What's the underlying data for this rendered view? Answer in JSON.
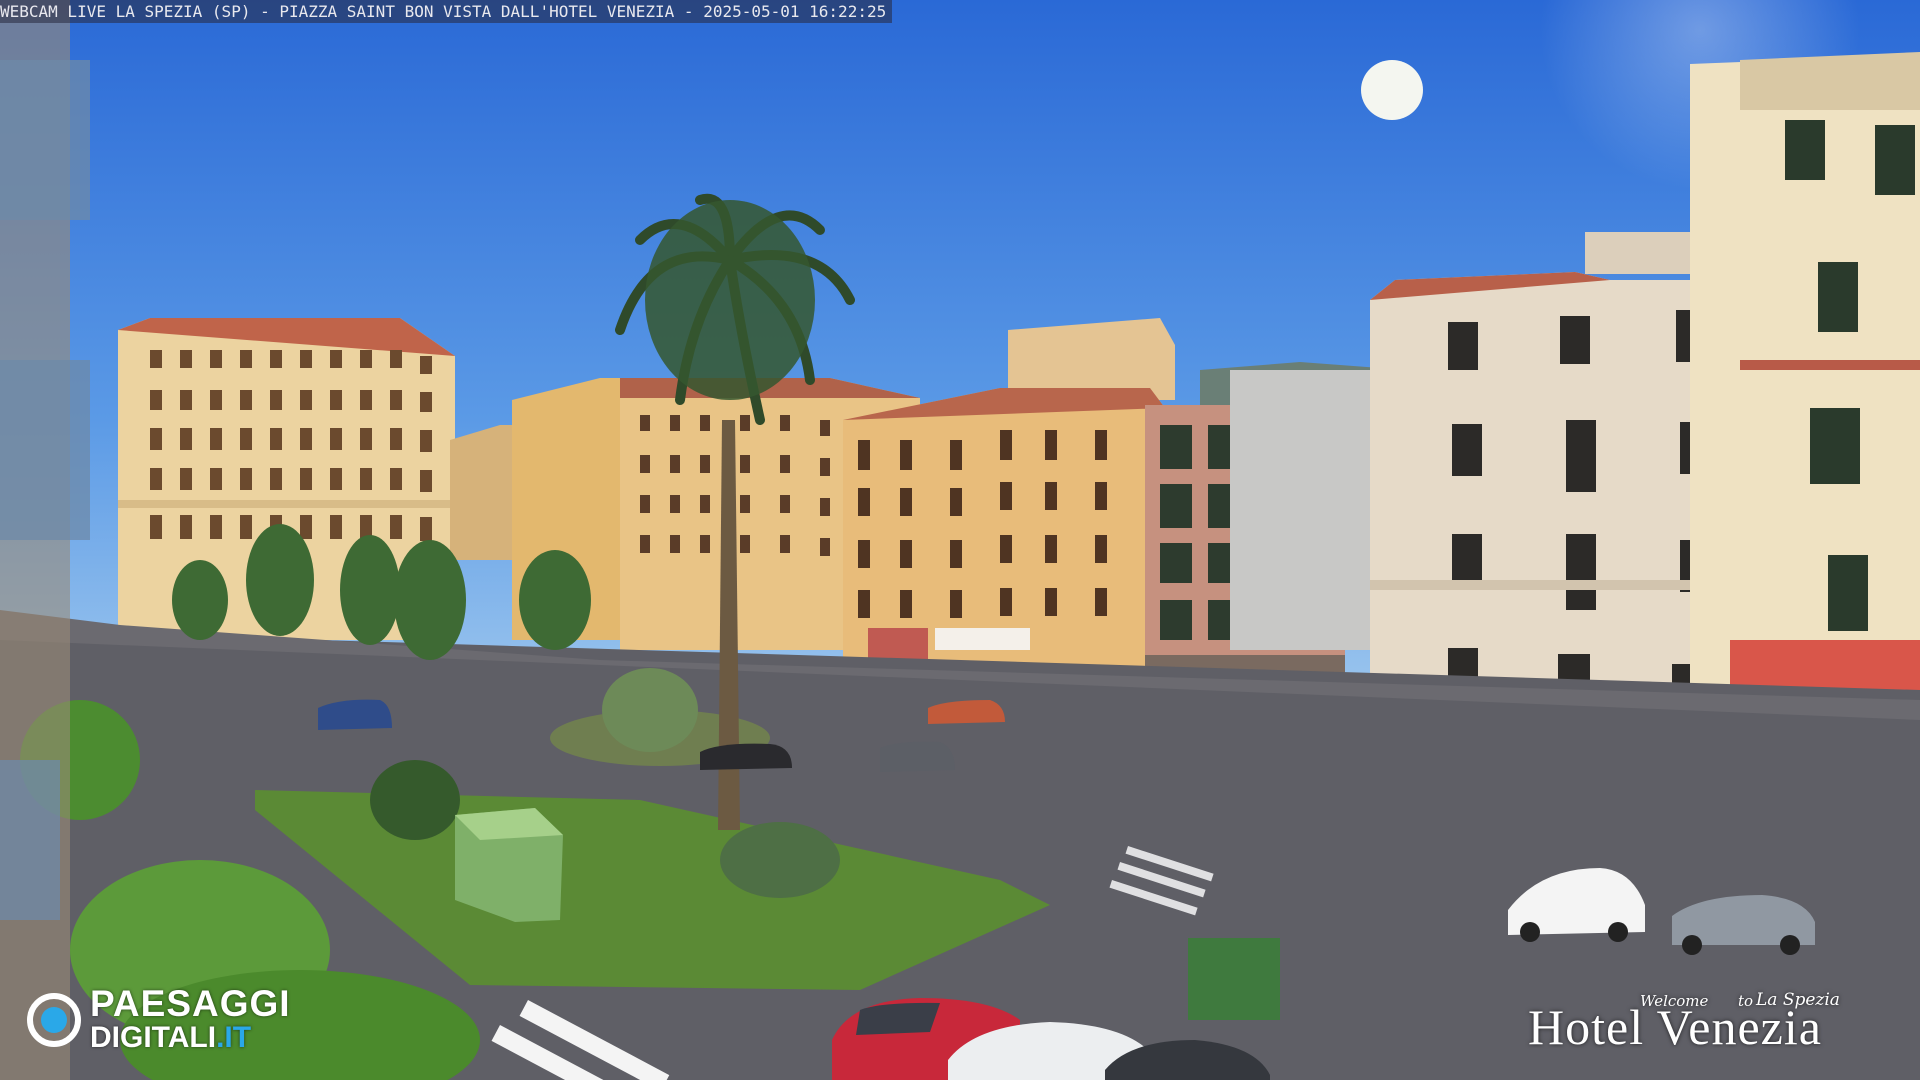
{
  "overlay": {
    "title": "WEBCAM LIVE LA SPEZIA (SP) - PIAZZA SAINT BON VISTA DALL'HOTEL VENEZIA - 2025-05-01 16:22:25"
  },
  "watermark_left": {
    "line1": "PAESAGGI",
    "line2": "DIGITALI",
    "line2_suffix": ".IT"
  },
  "watermark_right": {
    "welcome": "Welcome",
    "to": "to",
    "city": "La Spezia",
    "name": "Hotel Venezia"
  },
  "colors": {
    "sky_top": "#2f6fd8",
    "sky_bottom": "#8cc0ee",
    "building_cream": "#f0d8a8",
    "building_pink": "#c08878",
    "grass": "#5a8a34",
    "road": "#5c5c62"
  }
}
